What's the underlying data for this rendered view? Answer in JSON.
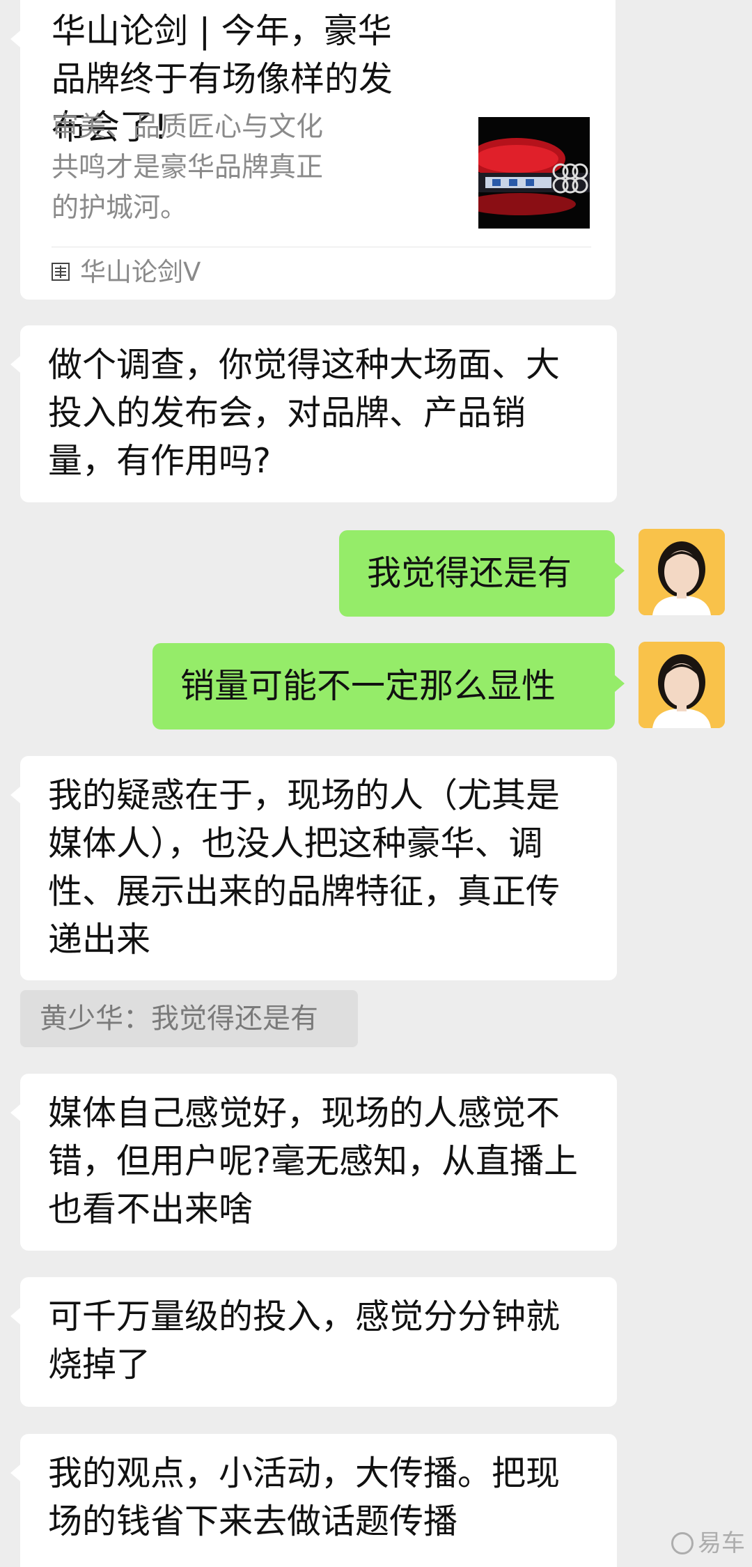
{
  "share_card": {
    "title": "华山论剑 | 今年，豪华品牌终于有场像样的发布会了!",
    "description": "审美、品质匠心与文化共鸣才是豪华品牌真正的护城河。",
    "logo_text": "华山论剑",
    "source_name": "华山论剑V",
    "thumbnail_icon": "audi-event-venue-image"
  },
  "messages": [
    {
      "side": "left",
      "text": "做个调查，你觉得这种大场面、大投入的发布会，对品牌、产品销量，有作用吗?"
    },
    {
      "side": "right",
      "text": "我觉得还是有"
    },
    {
      "side": "right",
      "text": "销量可能不一定那么显性"
    },
    {
      "side": "left",
      "text": "我的疑惑在于，现场的人（尤其是媒体人），也没人把这种豪华、调性、展示出来的品牌特征，真正传递出来"
    },
    {
      "side": "left",
      "text": "媒体自己感觉好，现场的人感觉不错，但用户呢?毫无感知，从直播上也看不出来啥"
    },
    {
      "side": "left",
      "text": "可千万量级的投入，感觉分分钟就烧掉了"
    },
    {
      "side": "left",
      "text": "我的观点，小活动，大传播。把现场的钱省下来去做话题传播"
    }
  ],
  "quote": {
    "text": "黄少华：我觉得还是有"
  },
  "watermark": {
    "text": "易车"
  },
  "colors": {
    "background": "#ededed",
    "bubble_left": "#ffffff",
    "bubble_right": "#95ec69",
    "avatar_bg": "#f9c24a"
  }
}
